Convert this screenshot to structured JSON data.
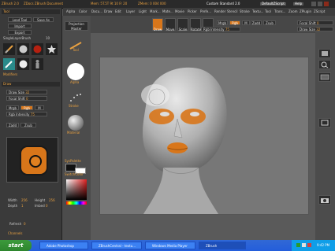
{
  "titlebar": {
    "app": "ZBrush 2.0",
    "items": [
      "ZDocs ZBrush Document",
      "Mem: 5T.5T 9t 10 Fr 20",
      "ZMem: 0 004 000"
    ],
    "preset": "Custom Standard 2.0",
    "script": "DefaultZScript",
    "help": "Help"
  },
  "menu": [
    "Alpha",
    "Color",
    "Docu...",
    "Draw",
    "Edit",
    "Layer",
    "Light",
    "Mark...",
    "Mate...",
    "Movie",
    "Picker",
    "Prefe...",
    "Render",
    "Stencil",
    "Stroke",
    "Textu...",
    "Tool",
    "Trans...",
    "Zoom",
    "ZPlugin",
    "ZScript"
  ],
  "left": {
    "tool_header": "Tool",
    "load_tool": "Load Tool",
    "save_as": "Save As",
    "import": "Import",
    "export": "Export",
    "single_layer": "SingleLayerBrush",
    "single_layer_val": "10",
    "modifiers": "Modifiers",
    "draw_header": "Draw",
    "draw_size": "Draw Size",
    "draw_size_val": "32",
    "focal_shift": "Focal Shift",
    "focal_shift_val": "0",
    "mrgb": "Mrgb",
    "rgb": "Rgb",
    "m": "M",
    "rgb_intensity": "Rgb Intensity",
    "rgb_intensity_val": "75",
    "zadd": "Zadd",
    "zsub": "Zsub",
    "width_label": "Width",
    "width_val": "256",
    "height_label": "Height",
    "height_val": "256",
    "depth_label": "Depth",
    "depth_val": "1",
    "imbed_label": "Imbed",
    "imbed_val": "0",
    "refresh": "Refresh",
    "refresh_val": "0",
    "channels": "Channels"
  },
  "mid": {
    "projection_master": "Projection Master",
    "tool": "Tool",
    "alpha": "Alpha",
    "stroke": "Stroke",
    "material": "Material",
    "syspalette": "SysPalette",
    "switchcolor": "SwitchColor"
  },
  "toolstrip": {
    "draw": "Draw",
    "move": "Move",
    "scale": "Scale",
    "rotate": "Rotate",
    "edit": "Edit",
    "mrgb": "Mrgb",
    "rgb": "Rgb",
    "m": "M",
    "zadd": "Zadd",
    "zsub": "Zsub",
    "rgb_intensity": "Rgb Intensity",
    "rgb_intensity_val": "75",
    "focal_shift": "Focal Shift",
    "focal_shift_val": "0",
    "draw_size": "Draw Size",
    "draw_size_val": "32"
  },
  "taskbar": {
    "start": "start",
    "tasks": [
      "Adobe Photoshop",
      "ZBrushCentral - textu...",
      "Windows Media Player",
      "ZBrush"
    ],
    "clock": "9:42 PM"
  },
  "colors": {
    "accent": "#d8761a",
    "taskbar": "#245edb",
    "start": "#2e862e"
  }
}
